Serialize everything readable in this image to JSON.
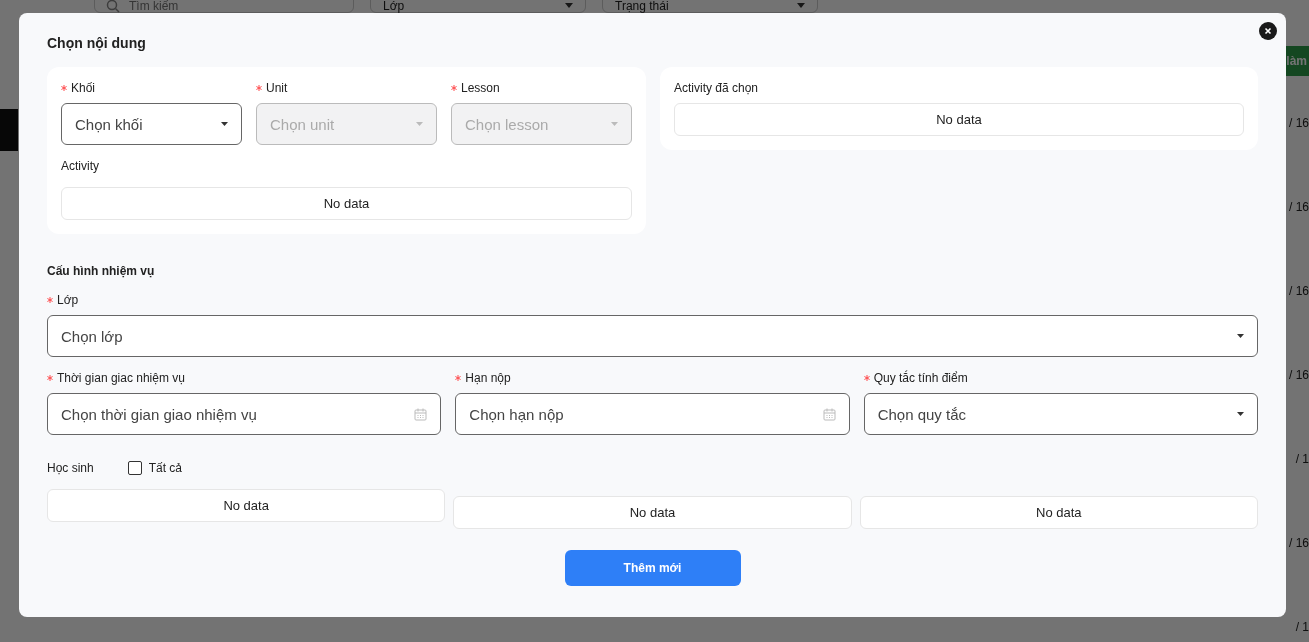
{
  "background": {
    "search": {
      "placeholder": "Tìm kiếm"
    },
    "filters": [
      "Lớp",
      "Trạng thái"
    ],
    "action_button": "làm",
    "row_fragments": [
      "/ 16",
      "/ 16",
      "/ 16",
      "/ 16",
      "/ 1",
      "/ 16",
      "/ 1"
    ]
  },
  "modal": {
    "title": "Chọn nội dung",
    "content_selects": [
      {
        "label": "Khối",
        "required": true,
        "placeholder": "Chọn khối",
        "disabled": false
      },
      {
        "label": "Unit",
        "required": true,
        "placeholder": "Chọn unit",
        "disabled": true
      },
      {
        "label": "Lesson",
        "required": true,
        "placeholder": "Chọn lesson",
        "disabled": true
      }
    ],
    "activity": {
      "label": "Activity",
      "empty_text": "No data"
    },
    "selected_activity": {
      "label": "Activity đã chọn",
      "empty_text": "No data"
    },
    "config_title": "Cấu hình nhiệm vụ",
    "class_select": {
      "label": "Lớp",
      "required": true,
      "placeholder": "Chọn lớp"
    },
    "fields": [
      {
        "label": "Thời gian giac nhiệm vụ",
        "required": true,
        "placeholder": "Chọn thời gian giao nhiệm vụ",
        "kind": "date"
      },
      {
        "label": "Hạn nộp",
        "required": true,
        "placeholder": "Chọn hạn nộp",
        "kind": "date"
      },
      {
        "label": "Quy tắc tính điểm",
        "required": true,
        "placeholder": "Chọn quy tắc",
        "kind": "select"
      }
    ],
    "students": {
      "label": "Học sinh",
      "select_all": {
        "label": "Tất cả",
        "checked": false
      },
      "lists": [
        "No data",
        "No data",
        "No data"
      ]
    },
    "submit_button": "Thêm mới"
  }
}
